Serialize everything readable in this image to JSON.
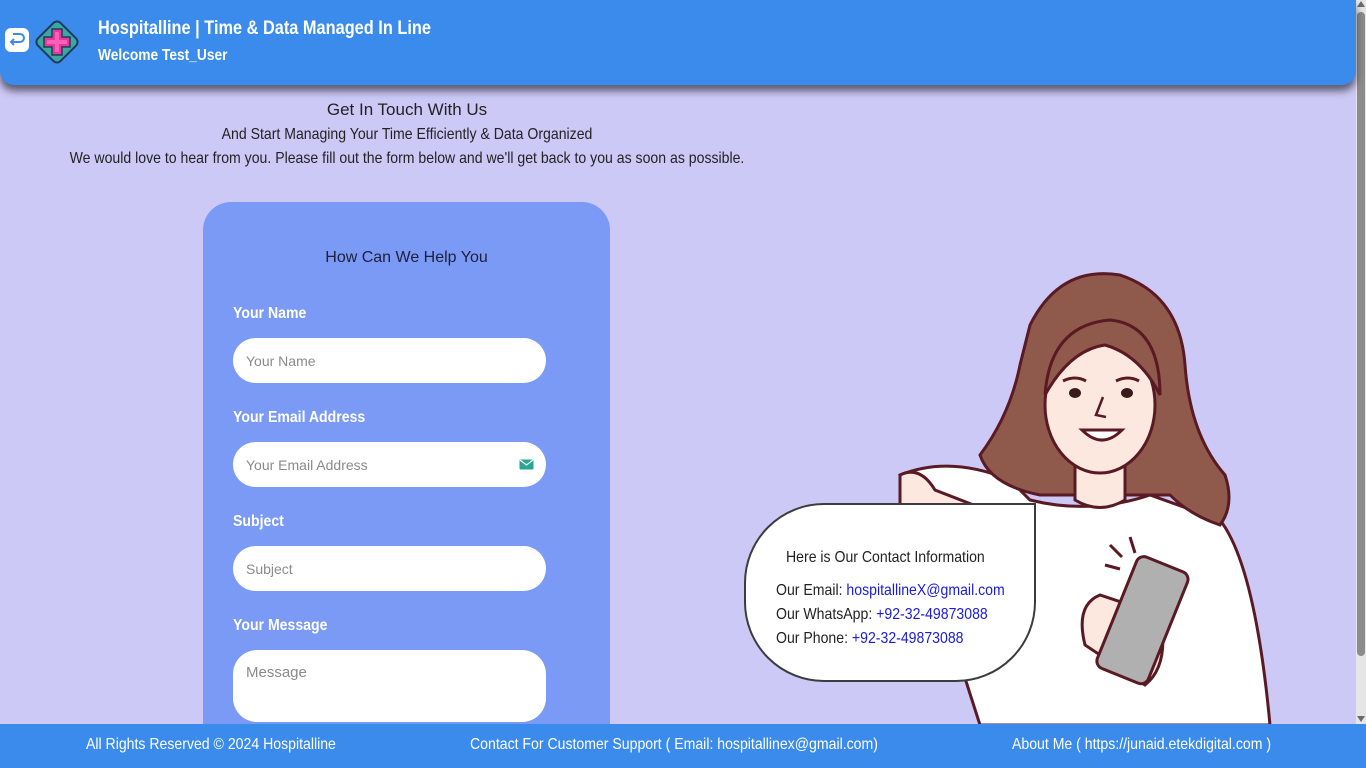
{
  "header": {
    "title": "Hospitalline | Time & Data Managed In Line",
    "welcome": "Welcome Test_User",
    "back_icon": "back-arrow-icon",
    "logo_icon": "medical-cross-logo"
  },
  "intro": {
    "title": "Get In Touch With Us",
    "subtitle": "And Start Managing Your Time Efficiently & Data Organized",
    "description": "We would love to hear from you. Please fill out the form below and we'll get back to you as soon as possible."
  },
  "form": {
    "heading": "How Can We Help You",
    "name_label": "Your Name",
    "name_placeholder": "Your Name",
    "email_label": "Your Email Address",
    "email_placeholder": "Your Email Address",
    "subject_label": "Subject",
    "subject_placeholder": "Subject",
    "message_label": "Your Message",
    "message_placeholder": "Message"
  },
  "contact": {
    "title": "Here is Our Contact Information",
    "email_prefix": "Our Email: ",
    "email": "hospitallineX@gmail.com",
    "whatsapp_prefix": "Our WhatsApp: ",
    "whatsapp": "+92-32-49873088",
    "phone_prefix": "Our Phone: ",
    "phone": "+92-32-49873088"
  },
  "footer": {
    "copyright": "All Rights Reserved © 2024 Hospitalline",
    "support": "Contact For Customer Support ( Email: hospitallinex@gmail.com)",
    "about": "About Me ( https://junaid.etekdigital.com )"
  },
  "colors": {
    "primary": "#3a8bec",
    "background": "#cdc9f7",
    "form_card": "#7b9af5",
    "link": "#1a1adb"
  }
}
